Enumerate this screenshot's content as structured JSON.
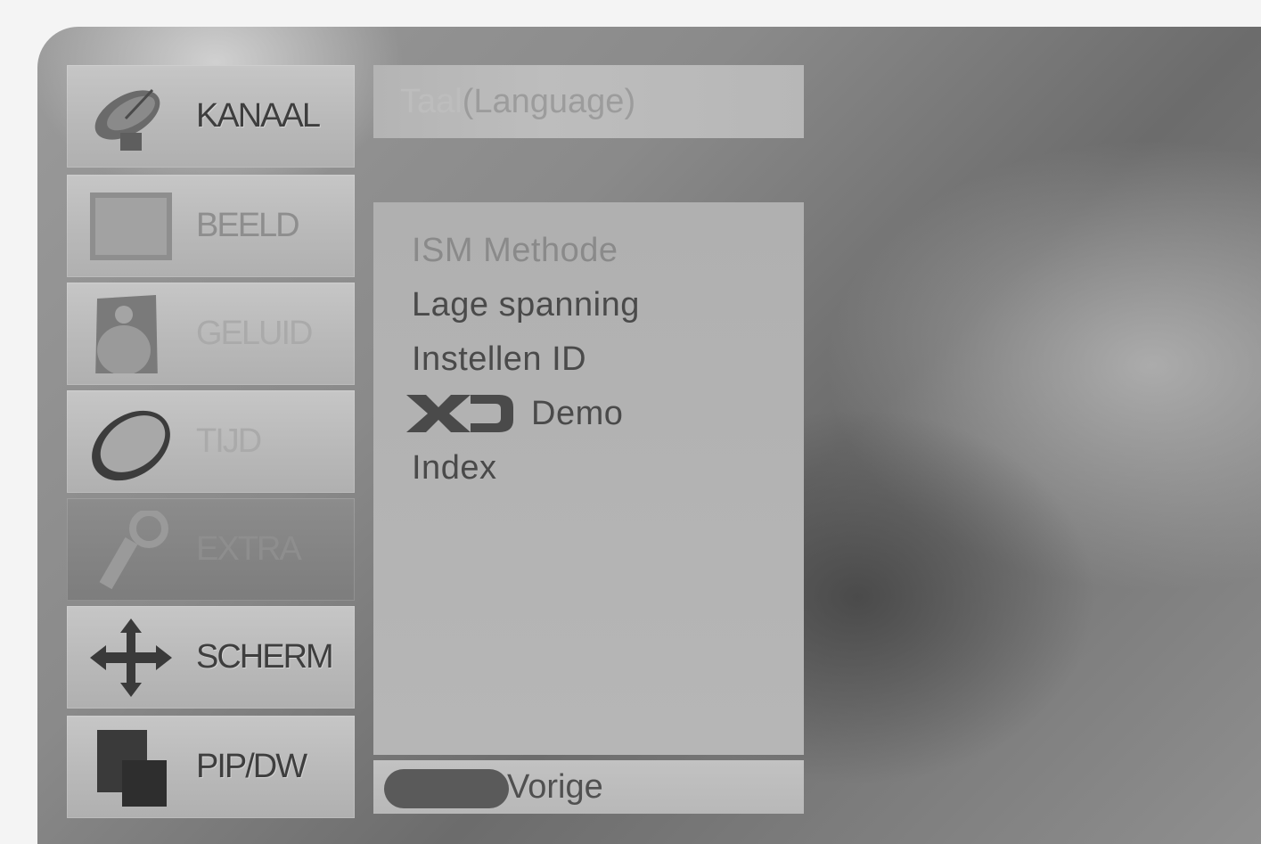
{
  "menu": {
    "items": [
      {
        "label": "KANAAL",
        "icon": "satellite-dish-icon"
      },
      {
        "label": "BEELD",
        "icon": "picture-screen-icon"
      },
      {
        "label": "GELUID",
        "icon": "speaker-icon"
      },
      {
        "label": "TIJD",
        "icon": "clock-icon"
      },
      {
        "label": "EXTRA",
        "icon": "key-icon"
      },
      {
        "label": "SCHERM",
        "icon": "move-arrows-icon"
      },
      {
        "label": "PIP/DW",
        "icon": "pip-windows-icon"
      }
    ],
    "selected": "EXTRA"
  },
  "submenu": {
    "title_dim": "Taal",
    "title_rest": "(Language)",
    "options": [
      {
        "label": "ISM Methode"
      },
      {
        "label": "Lage spanning"
      },
      {
        "label": "Instellen ID"
      },
      {
        "label": "Demo",
        "logo": "XD"
      },
      {
        "label": "Index"
      }
    ]
  },
  "footer": {
    "back_label": "Vorige"
  }
}
